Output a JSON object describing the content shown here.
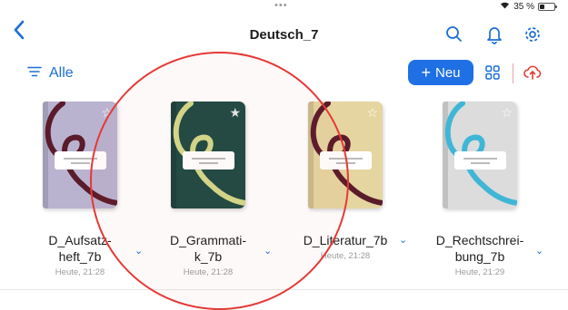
{
  "status": {
    "dots": "•••",
    "battery": "35 %"
  },
  "header": {
    "title": "Deutsch_7"
  },
  "toolbar": {
    "filter_label": "Alle",
    "new_label": "Neu"
  },
  "books": [
    {
      "name": "D_Aufsatz-\nheft_7b",
      "time": "Heute, 21:28",
      "cover": "#b9b3d0",
      "ribbon": "#5a1b2b",
      "starred": false
    },
    {
      "name": "D_Grammati-\nk_7b",
      "time": "Heute, 21:28",
      "cover": "#1f4b44",
      "ribbon": "#d3d98a",
      "starred": true
    },
    {
      "name": "D_Literatur_7b",
      "time": "Heute, 21:28",
      "cover": "#e5d5a0",
      "ribbon": "#5a1b2b",
      "starred": false
    },
    {
      "name": "D_Rechtschrei-\nbung_7b",
      "time": "Heute, 21:29",
      "cover": "#dcdcdc",
      "ribbon": "#3fb6d6",
      "starred": false
    }
  ]
}
